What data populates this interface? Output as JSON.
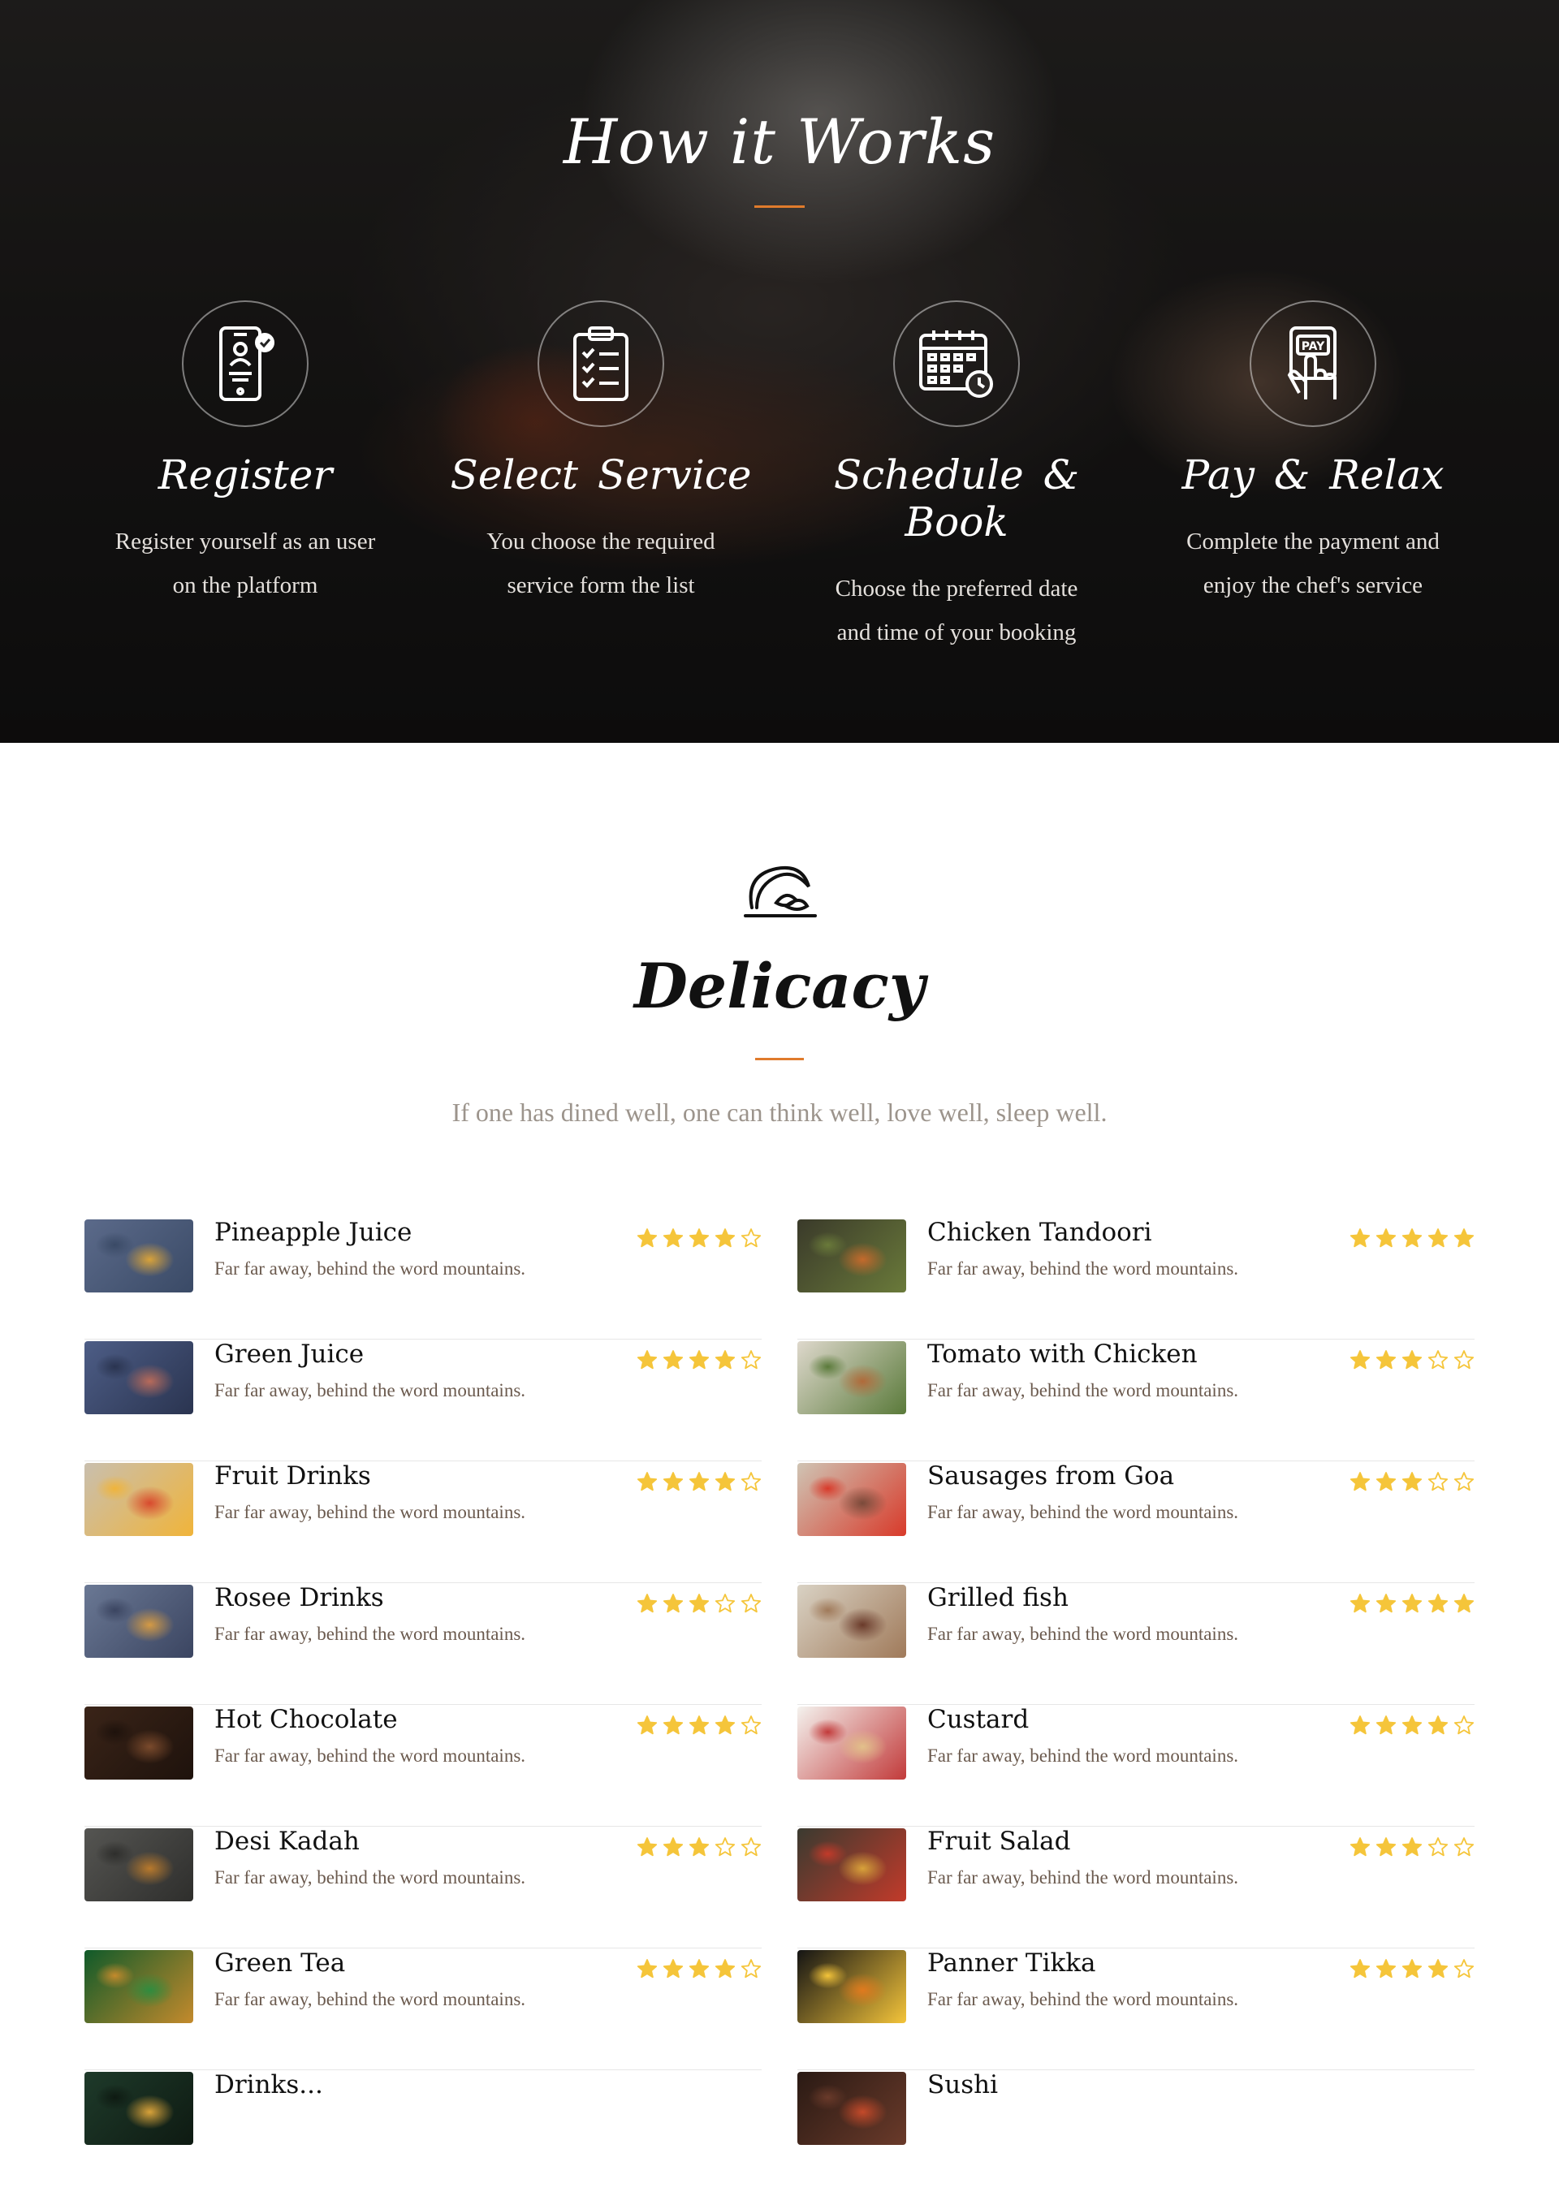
{
  "hero": {
    "title": "How it Works",
    "accent_color": "#e07b2c",
    "steps": [
      {
        "icon": "phone-register-icon",
        "title": "Register",
        "desc_line1": "Register yourself as an user",
        "desc_line2": "on the platform"
      },
      {
        "icon": "clipboard-checklist-icon",
        "title": "Select Service",
        "desc_line1": "You choose the required",
        "desc_line2": "service form the list"
      },
      {
        "icon": "calendar-clock-icon",
        "title": "Schedule & Book",
        "desc_line1": "Choose the preferred date",
        "desc_line2": "and time of your booking"
      },
      {
        "icon": "pay-hand-icon",
        "title": "Pay & Relax",
        "desc_line1": "Complete the payment and",
        "desc_line2": "enjoy the chef's service"
      }
    ]
  },
  "delicacy": {
    "icon": "cloche-icon",
    "title": "Delicacy",
    "subtitle": "If one has dined well, one can think well, love well, sleep well.",
    "star_color": "#f5c53a",
    "left_items": [
      {
        "name": "Pineapple Juice",
        "desc": "Far far away, behind the word mountains.",
        "rating": 4
      },
      {
        "name": "Green Juice",
        "desc": "Far far away, behind the word mountains.",
        "rating": 4
      },
      {
        "name": "Fruit Drinks",
        "desc": "Far far away, behind the word mountains.",
        "rating": 4
      },
      {
        "name": "Rosee Drinks",
        "desc": "Far far away, behind the word mountains.",
        "rating": 3
      },
      {
        "name": "Hot Chocolate",
        "desc": "Far far away, behind the word mountains.",
        "rating": 4
      },
      {
        "name": "Desi Kadah",
        "desc": "Far far away, behind the word mountains.",
        "rating": 3
      },
      {
        "name": "Green Tea",
        "desc": "Far far away, behind the word mountains.",
        "rating": 4
      },
      {
        "name": "Drinks...",
        "desc": "",
        "rating": 0
      }
    ],
    "right_items": [
      {
        "name": "Chicken Tandoori",
        "desc": "Far far away, behind the word mountains.",
        "rating": 5
      },
      {
        "name": "Tomato with Chicken",
        "desc": "Far far away, behind the word mountains.",
        "rating": 3
      },
      {
        "name": "Sausages from Goa",
        "desc": "Far far away, behind the word mountains.",
        "rating": 3
      },
      {
        "name": "Grilled fish",
        "desc": "Far far away, behind the word mountains.",
        "rating": 5
      },
      {
        "name": "Custard",
        "desc": "Far far away, behind the word mountains.",
        "rating": 4
      },
      {
        "name": "Fruit Salad",
        "desc": "Far far away, behind the word mountains.",
        "rating": 3
      },
      {
        "name": "Panner Tikka",
        "desc": "Far far away, behind the word mountains.",
        "rating": 4
      },
      {
        "name": "Sushi",
        "desc": "",
        "rating": 0
      }
    ]
  }
}
